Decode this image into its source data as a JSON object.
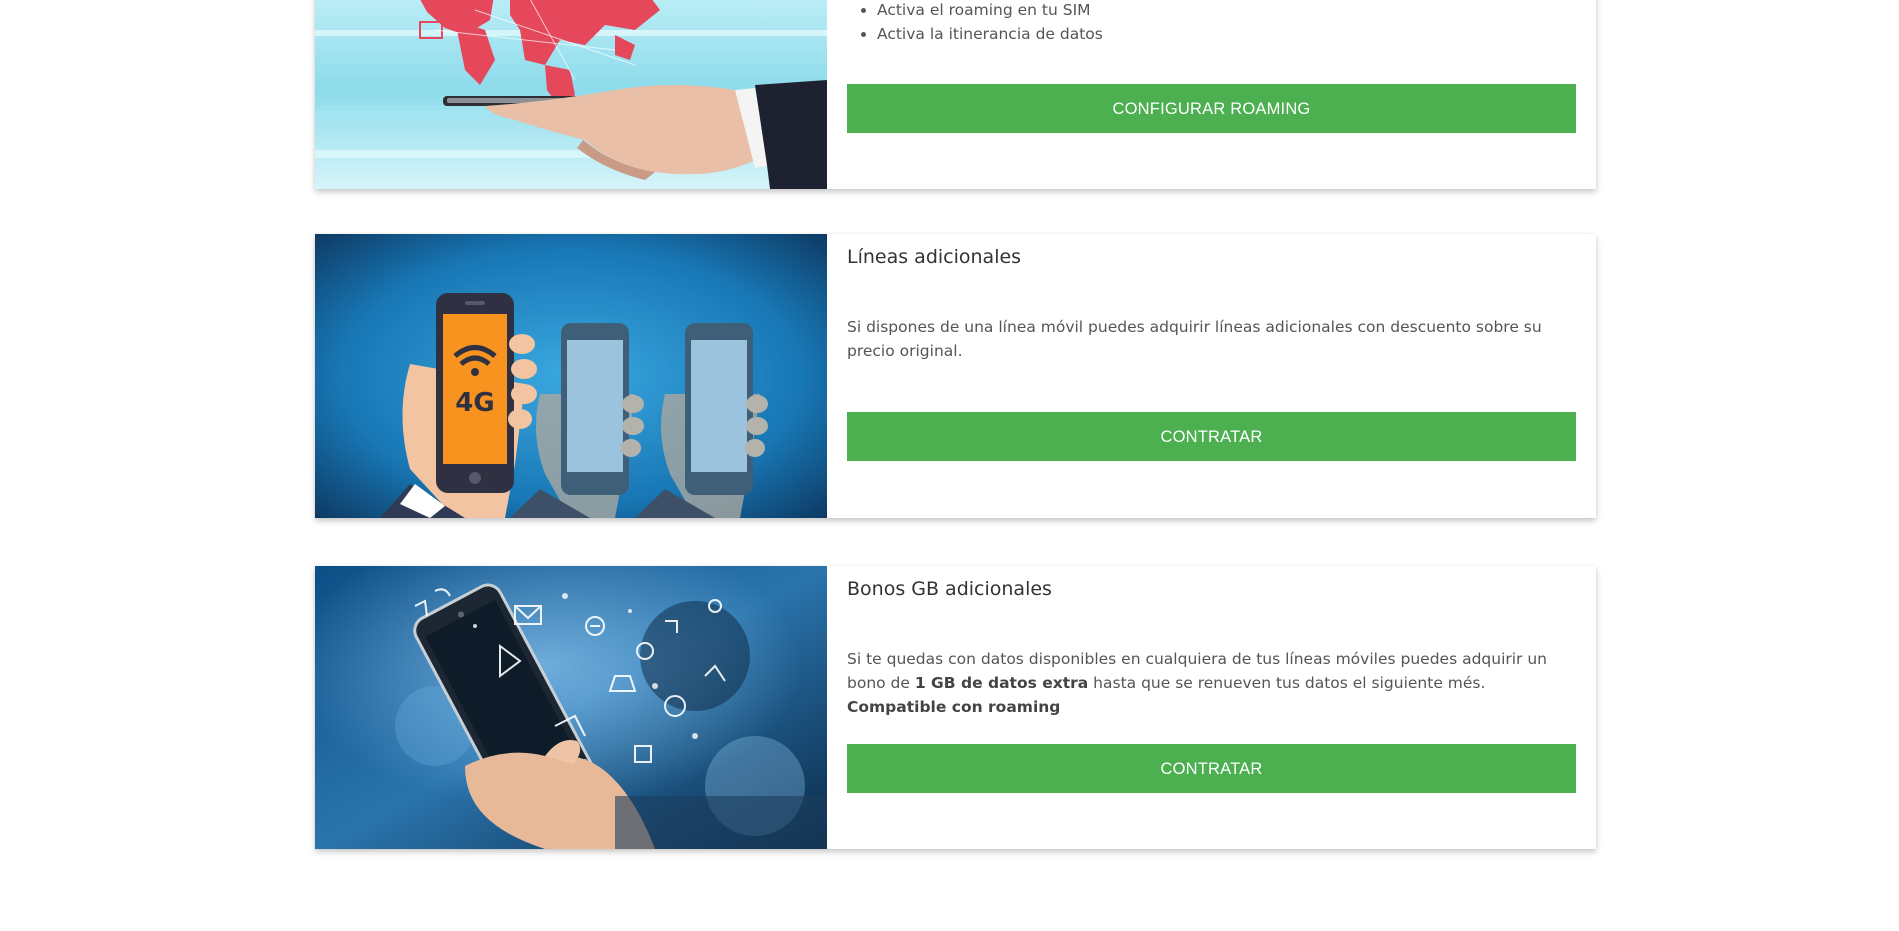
{
  "cards": [
    {
      "bullets": [
        "Activa el roaming en tu SIM",
        "Activa la itinerancia de datos"
      ],
      "button_label": "CONFIGURAR ROAMING",
      "image_icon": "roaming-world-phone-image"
    },
    {
      "title": "Líneas adicionales",
      "text": "Si dispones de una línea móvil puedes adquirir líneas adicionales con descuento sobre su precio original.",
      "button_label": "CONTRATAR",
      "image_label": "4G",
      "image_icon": "phones-4g-image"
    },
    {
      "title": "Bonos GB adicionales",
      "text_before": "Si te quedas con datos disponibles en cualquiera de tus líneas móviles puedes adquirir un bono de ",
      "text_bold1": "1 GB de datos extra",
      "text_middle": " hasta que se renueven tus datos el siguiente més. ",
      "text_bold2": "Compatible con roaming",
      "button_label": "CONTRATAR",
      "image_icon": "smartphone-apps-image"
    }
  ],
  "colors": {
    "button": "#4caf50",
    "title": "#333333",
    "text": "#555555"
  }
}
